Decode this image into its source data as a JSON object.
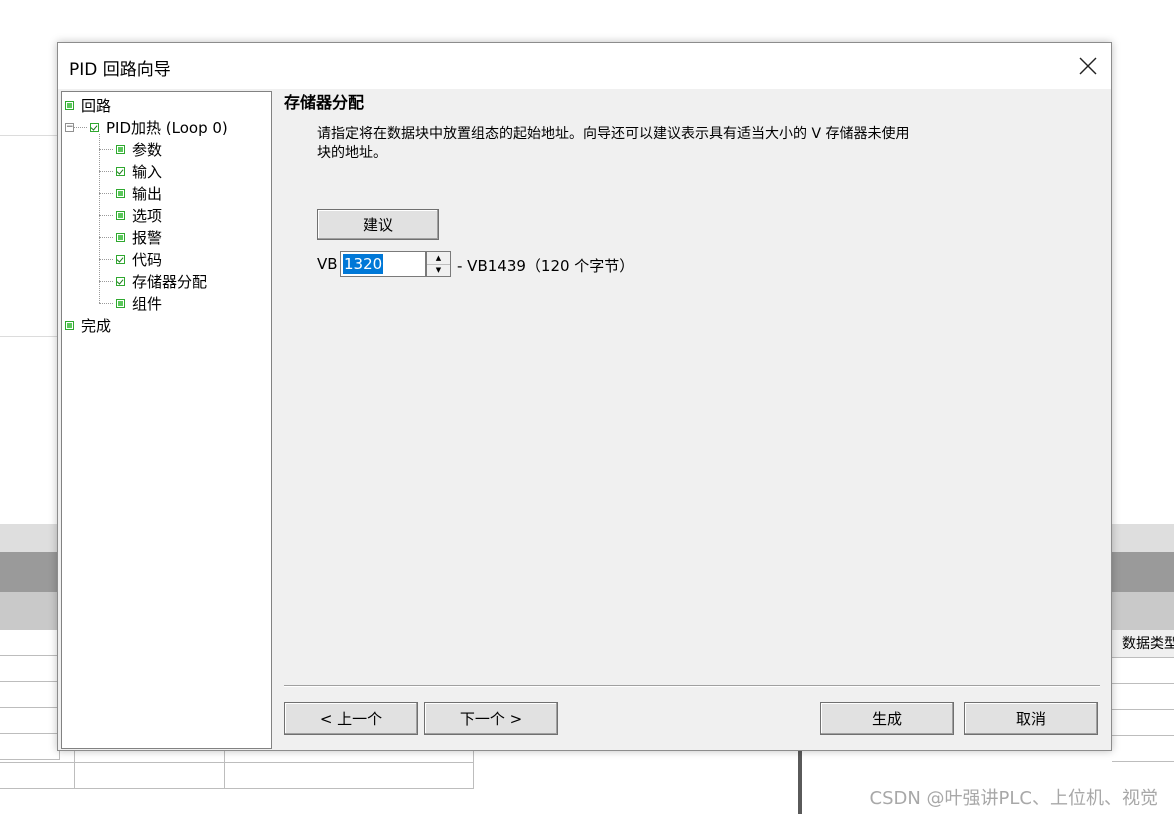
{
  "dialog": {
    "title": "PID 回路向导",
    "close_icon": "close-icon"
  },
  "tree": {
    "items": [
      {
        "label": "回路",
        "state": "done"
      },
      {
        "label": "PID加热 (Loop 0)",
        "state": "checked"
      },
      {
        "label": "参数",
        "state": "done"
      },
      {
        "label": "输入",
        "state": "checked"
      },
      {
        "label": "输出",
        "state": "done"
      },
      {
        "label": "选项",
        "state": "done"
      },
      {
        "label": "报警",
        "state": "done"
      },
      {
        "label": "代码",
        "state": "checked"
      },
      {
        "label": "存储器分配",
        "state": "checked"
      },
      {
        "label": "组件",
        "state": "done"
      },
      {
        "label": "完成",
        "state": "done"
      }
    ]
  },
  "page": {
    "heading": "存储器分配",
    "description_line1": "请指定将在数据块中放置组态的起始地址。向导还可以建议表示具有适当大小的 V 存储器未使用",
    "description_line2": "块的地址。",
    "suggest_button": "建议",
    "vb_label": "VB",
    "start_address": "1320",
    "range_text": "- VB1439（120 个字节）"
  },
  "footer": {
    "prev_button": "< 上一个",
    "next_button": "下一个 >",
    "generate_button": "生成",
    "cancel_button": "取消"
  },
  "background": {
    "column_header": "数据类型",
    "watermark": "CSDN @叶强讲PLC、上位机、视觉"
  },
  "colors": {
    "selection": "#0078d7",
    "check_green": "#2fa82f",
    "dialog_bg": "#f0f0f0"
  }
}
